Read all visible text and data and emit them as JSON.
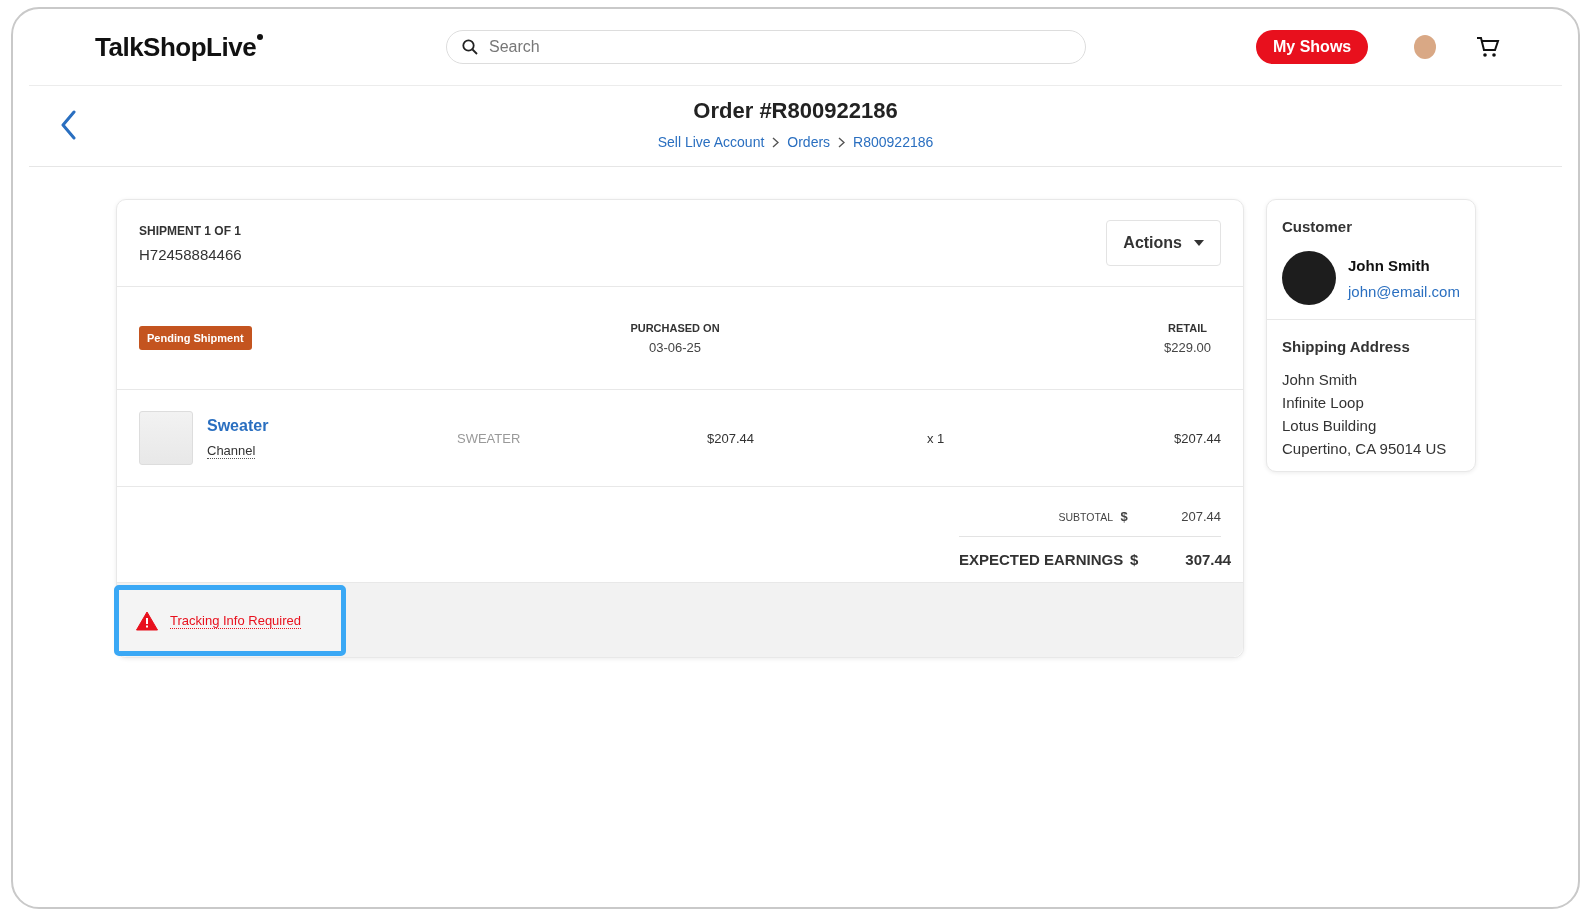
{
  "header": {
    "logo": "TalkShopLive",
    "search": {
      "placeholder": "Search"
    },
    "my_shows_button": "My Shows"
  },
  "page": {
    "title": "Order #R800922186",
    "breadcrumbs": [
      {
        "label": "Sell Live Account"
      },
      {
        "label": "Orders"
      },
      {
        "label": "R800922186"
      }
    ]
  },
  "shipment": {
    "heading": "SHIPMENT 1 OF 1",
    "tracking_number": "H72458884466",
    "actions_button": "Actions",
    "status_badge": "Pending Shipment",
    "purchased_on": {
      "label": "PURCHASED ON",
      "value": "03-06-25"
    },
    "retail": {
      "label": "RETAIL",
      "value": "$229.00"
    },
    "items": [
      {
        "name": "Sweater",
        "brand": "Channel",
        "category": "SWEATER",
        "price": "$207.44",
        "quantity": "x 1",
        "total": "$207.44"
      }
    ],
    "totals": [
      {
        "kind": "minor",
        "label": "SUBTOTAL",
        "currency": "$",
        "amount": "207.44"
      },
      {
        "kind": "major",
        "label": "EXPECTED EARNINGS",
        "currency": "$",
        "amount": "307.44"
      }
    ],
    "alert": {
      "text": "Tracking Info Required"
    }
  },
  "customer": {
    "heading": "Customer",
    "name": "John Smith",
    "email": "john@email.com"
  },
  "shipping_address": {
    "heading": "Shipping Address",
    "lines": [
      "John Smith",
      "Infinite Loop",
      "Lotus Building",
      "Cupertino, CA 95014 US"
    ]
  }
}
